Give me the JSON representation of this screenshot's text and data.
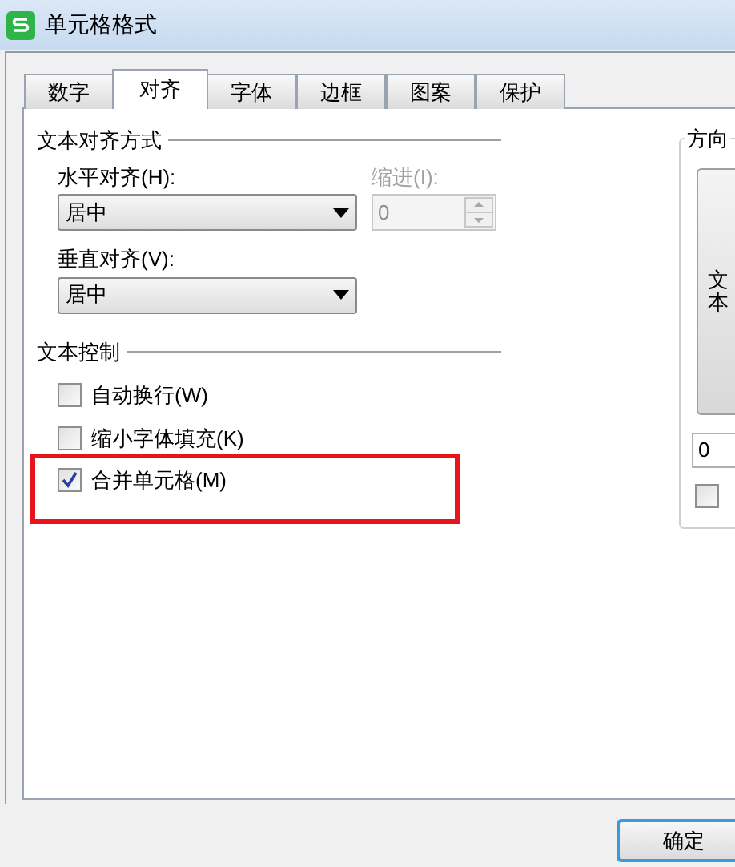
{
  "window": {
    "title": "单元格格式"
  },
  "tabs": [
    {
      "label": "数字",
      "selected": false
    },
    {
      "label": "对齐",
      "selected": true
    },
    {
      "label": "字体",
      "selected": false
    },
    {
      "label": "边框",
      "selected": false
    },
    {
      "label": "图案",
      "selected": false
    },
    {
      "label": "保护",
      "selected": false
    }
  ],
  "alignment": {
    "title": "文本对齐方式",
    "horizontal": {
      "label": "水平对齐(H):",
      "value": "居中"
    },
    "indent": {
      "label": "缩进(I):",
      "value": "0",
      "disabled": true
    },
    "vertical": {
      "label": "垂直对齐(V):",
      "value": "居中"
    }
  },
  "text_control": {
    "title": "文本控制",
    "options": [
      {
        "label": "自动换行(W)",
        "checked": false,
        "highlighted": false
      },
      {
        "label": "缩小字体填充(K)",
        "checked": false,
        "highlighted": false
      },
      {
        "label": "合并单元格(M)",
        "checked": true,
        "highlighted": true
      }
    ]
  },
  "orientation": {
    "title": "方向",
    "vertical_text": "文本",
    "degrees": "0",
    "checkbox_checked": false
  },
  "buttons": [
    {
      "label": "确定"
    }
  ]
}
